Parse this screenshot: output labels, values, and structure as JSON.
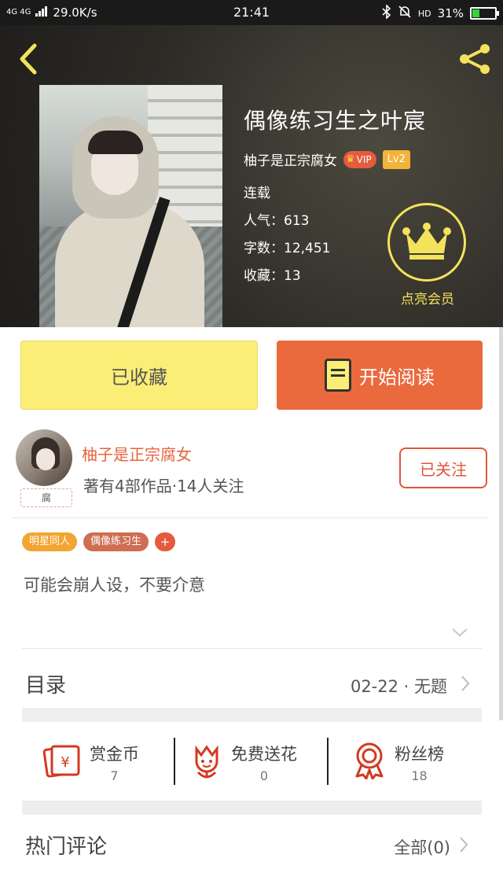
{
  "status_bar": {
    "network": "4G 4G",
    "speed": "29.0K/s",
    "time": "21:41",
    "hd": "HD",
    "battery": "31%",
    "battery_level": 0.31
  },
  "book": {
    "title": "偶像练习生之叶宸",
    "author": "柚子是正宗腐女",
    "vip_label": "VIP",
    "level": "Lv2",
    "status": "连载",
    "popularity": "人气：613",
    "word_count": "字数：12,451",
    "favorites": "收藏：13",
    "member_label": "点亮会员"
  },
  "actions": {
    "favorited_label": "已收藏",
    "read_label": "开始阅读"
  },
  "author_card": {
    "name": "柚子是正宗腐女",
    "summary": "著有4部作品·14人关注",
    "badge": "腐",
    "follow_label": "已关注"
  },
  "tags": [
    "明星同人",
    "偶像练习生"
  ],
  "tag_add": "+",
  "description": "可能会崩人设，不要介意",
  "toc": {
    "label": "目录",
    "latest": "02-22 · 无题"
  },
  "stats": [
    {
      "label": "赏金币",
      "value": "7"
    },
    {
      "label": "免费送花",
      "value": "0"
    },
    {
      "label": "粉丝榜",
      "value": "18"
    }
  ],
  "comments": {
    "label": "热门评论",
    "all_label": "全部(0)"
  },
  "colors": {
    "accent_orange": "#ea6a3e",
    "favorite_yellow": "#fbee76",
    "member_yellow": "#f4e25c",
    "icon_red": "#d4391f"
  }
}
